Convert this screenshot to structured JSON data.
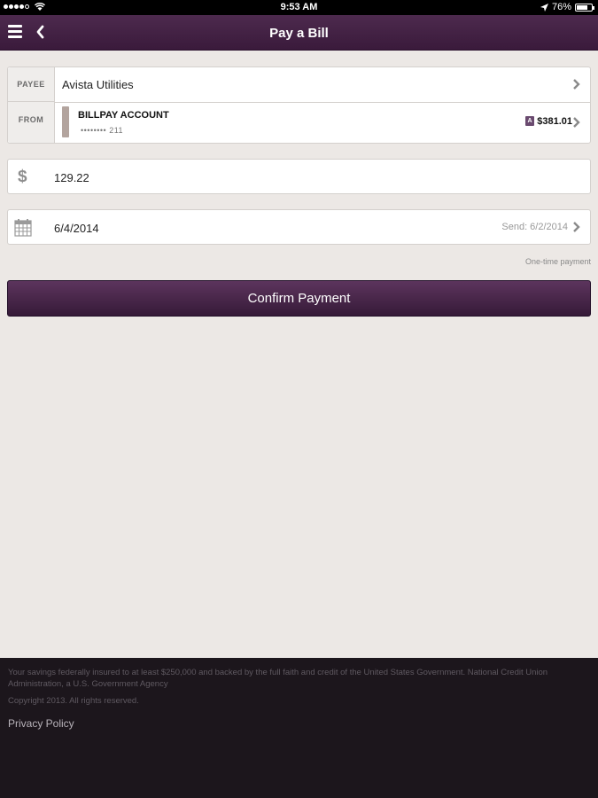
{
  "status_bar": {
    "time": "9:53 AM",
    "battery": "76%",
    "battery_level": 0.76
  },
  "navbar": {
    "title": "Pay a Bill"
  },
  "payee": {
    "label": "PAYEE",
    "value": "Avista Utilities"
  },
  "from": {
    "label": "FROM",
    "account_name": "BILLPAY ACCOUNT",
    "account_mask": "•••••••• 211",
    "badge": "A",
    "balance": "$381.01"
  },
  "amount": {
    "icon": "dollar-icon",
    "symbol": "$",
    "value": "129.22"
  },
  "date": {
    "icon": "calendar-icon",
    "value": "6/4/2014",
    "send_label": "Send: 6/2/2014"
  },
  "frequency": "One-time payment",
  "confirm_label": "Confirm Payment",
  "footer": {
    "disclaimer": "Your savings federally insured to at least $250,000 and backed by the full faith and credit of the United States Government. National Credit Union Administration, a U.S. Government Agency",
    "copyright": "Copyright 2013. All rights reserved.",
    "privacy_label": "Privacy Policy"
  },
  "colors": {
    "nav_purple": "#3f1e40",
    "button_purple": "#4a264b",
    "footer_bg": "#1c161c",
    "page_bg": "#ece8e5"
  }
}
